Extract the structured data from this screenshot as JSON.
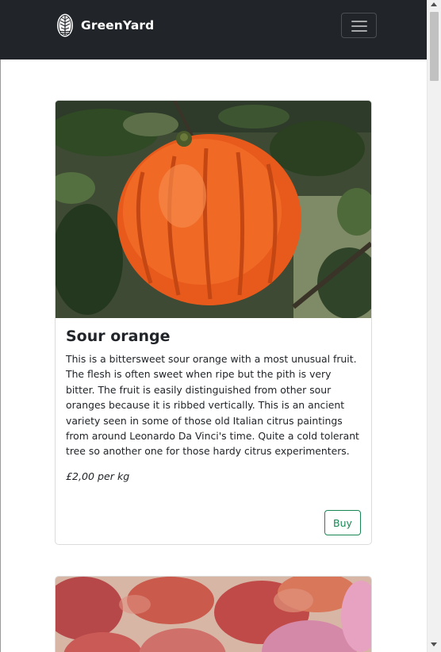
{
  "nav": {
    "brand": "GreenYard",
    "menu_icon": "hamburger-menu-icon"
  },
  "products": [
    {
      "title": "Sour orange",
      "description": "This is a bittersweet sour orange with a most unusual fruit. The flesh is often sweet when ripe but the pith is very bitter. The fruit is easily distinguished from other sour oranges because it is ribbed vertically. This is an ancient variety seen in some of those old Italian citrus paintings from around Leonardo Da Vinci's time. Quite a cold tolerant tree so another one for those hardy citrus experimenters.",
      "price": "£2,00 per kg",
      "buy_label": "Buy"
    }
  ],
  "colors": {
    "navbar": "#212529",
    "accent": "#198754"
  }
}
